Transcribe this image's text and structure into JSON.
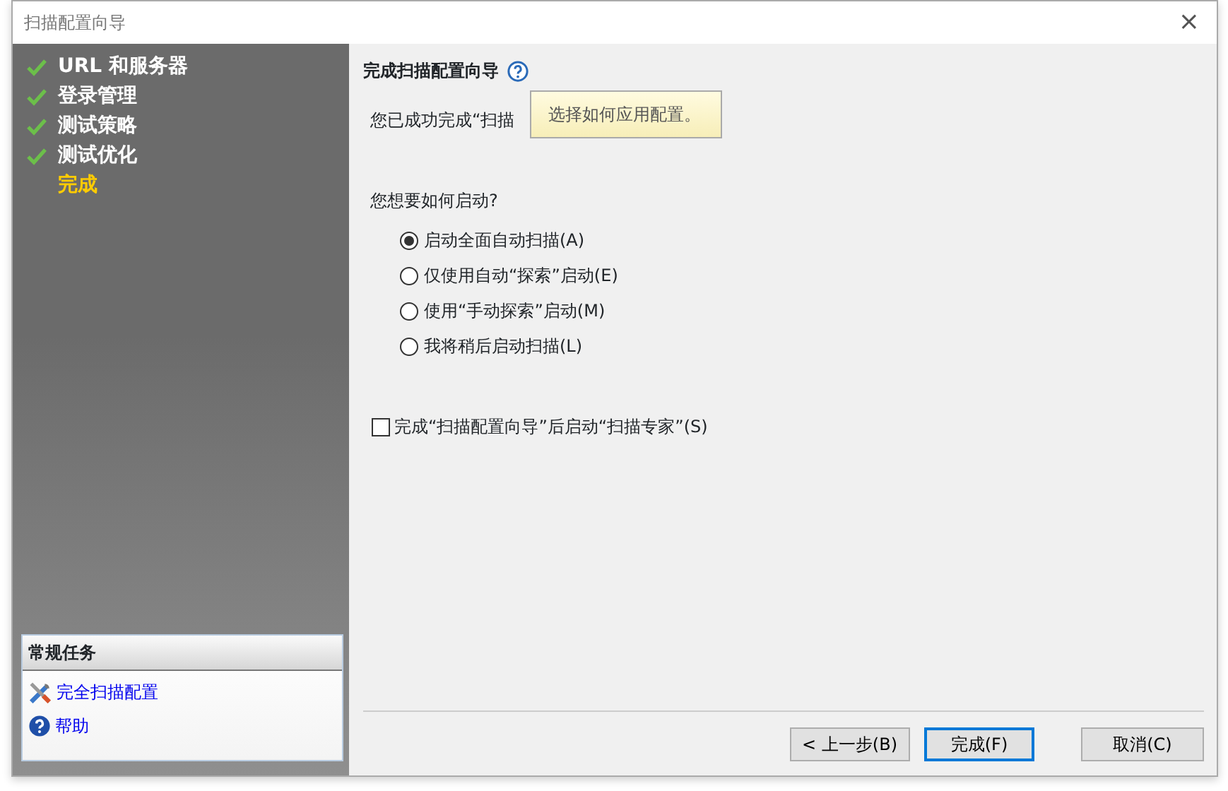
{
  "window": {
    "title": "扫描配置向导",
    "close": "×"
  },
  "steps": [
    {
      "label": "URL 和服务器",
      "done": true,
      "selected": false
    },
    {
      "label": "登录管理",
      "done": true,
      "selected": false
    },
    {
      "label": "测试策略",
      "done": true,
      "selected": false
    },
    {
      "label": "测试优化",
      "done": true,
      "selected": false
    },
    {
      "label": "完成",
      "done": false,
      "selected": true
    }
  ],
  "tasks": {
    "title": "常规任务",
    "items": [
      {
        "kind": "tools",
        "label": "完全扫描配置"
      },
      {
        "kind": "help",
        "label": "帮助"
      }
    ]
  },
  "page": {
    "heading": "完成扫描配置向导",
    "intro": "您已成功完成“扫描",
    "tooltip": "选择如何应用配置。",
    "question": "您想要如何启动?",
    "options": [
      {
        "label": "启动全面自动扫描(A)",
        "selected": true
      },
      {
        "label": "仅使用自动“探索”启动(E)",
        "selected": false
      },
      {
        "label": "使用“手动探索”启动(M)",
        "selected": false
      },
      {
        "label": "我将稍后启动扫描(L)",
        "selected": false
      }
    ],
    "checkbox": {
      "label": "完成“扫描配置向导”后启动“扫描专家”(S)",
      "checked": false
    }
  },
  "buttons": [
    {
      "label": "< 上一步(B)",
      "default": false
    },
    {
      "label": "完成(F)",
      "default": true
    },
    {
      "label": "取消(C)",
      "default": false
    }
  ]
}
